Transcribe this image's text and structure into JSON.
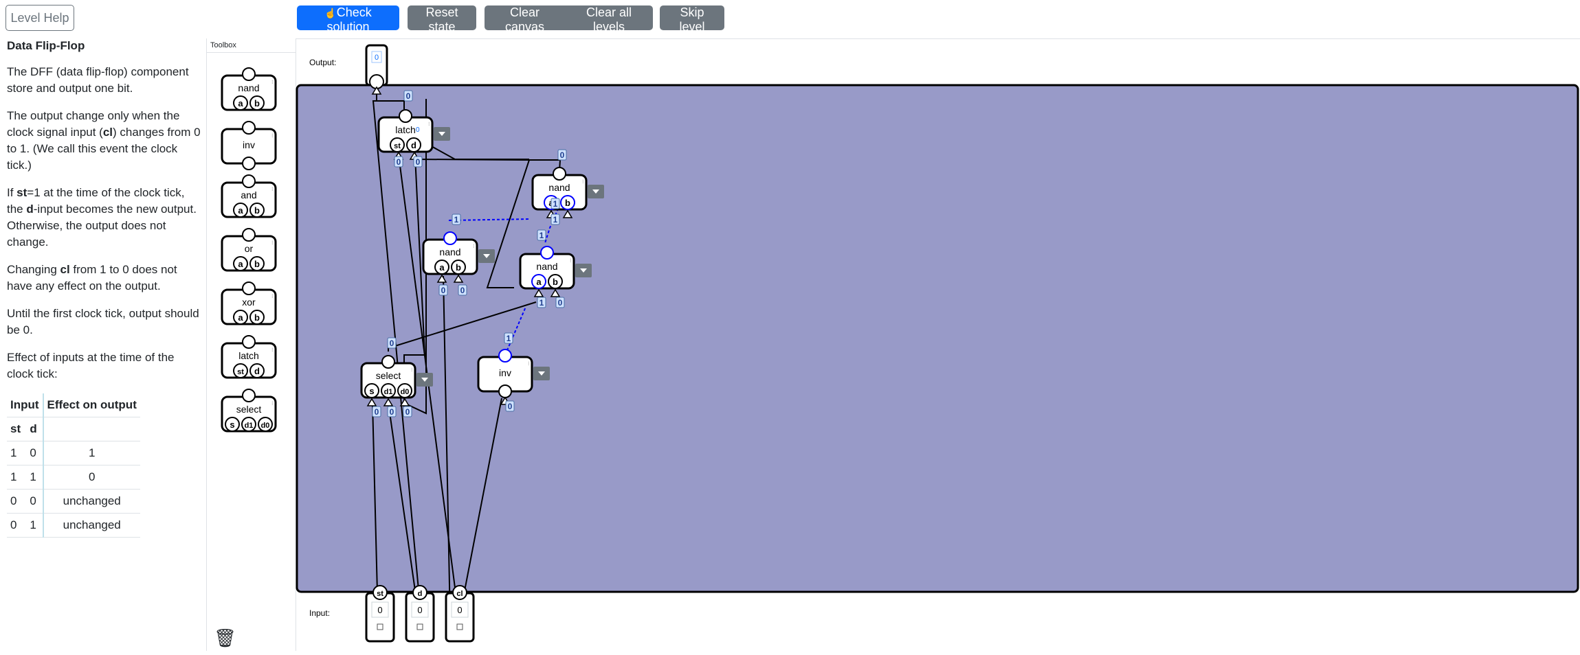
{
  "toolbar": {
    "level_help": "Level Help",
    "check": "Check solution",
    "reset": "Reset state",
    "clear_canvas": "Clear canvas",
    "clear_levels": "Clear all levels",
    "skip": "Skip level"
  },
  "help": {
    "title": "Data Flip-Flop",
    "p1": "The DFF (data flip-flop) component store and output one bit.",
    "p2a": "The output change only when the clock signal input (",
    "p2b": "cl",
    "p2c": ") changes from 0 to 1. (We call this event the clock tick.)",
    "p3a": "If ",
    "p3b": "st",
    "p3c": "=1 at the time of the clock tick, the ",
    "p3d": "d",
    "p3e": "-input becomes the new output. Otherwise, the output does not change.",
    "p4a": "Changing ",
    "p4b": "cl",
    "p4c": " from 1 to 0 does not have any effect on the output.",
    "p5": "Until the first clock tick, output should be 0.",
    "p6": "Effect of inputs at the time of the clock tick:",
    "table": {
      "h_input": "Input",
      "h_effect": "Effect on output",
      "h_st": "st",
      "h_d": "d",
      "rows": [
        {
          "st": "1",
          "d": "0",
          "effect": "1"
        },
        {
          "st": "1",
          "d": "1",
          "effect": "0"
        },
        {
          "st": "0",
          "d": "0",
          "effect": "unchanged"
        },
        {
          "st": "0",
          "d": "1",
          "effect": "unchanged"
        }
      ]
    }
  },
  "toolbox": {
    "title": "Toolbox",
    "items": [
      {
        "label": "nand",
        "pins": [
          "a",
          "b"
        ]
      },
      {
        "label": "inv",
        "pins": []
      },
      {
        "label": "and",
        "pins": [
          "a",
          "b"
        ]
      },
      {
        "label": "or",
        "pins": [
          "a",
          "b"
        ]
      },
      {
        "label": "xor",
        "pins": [
          "a",
          "b"
        ]
      },
      {
        "label": "latch",
        "pins": [
          "st",
          "d"
        ]
      },
      {
        "label": "select",
        "pins": [
          "s",
          "d1",
          "d0"
        ]
      }
    ]
  },
  "canvas": {
    "output_label": "Output:",
    "input_label": "Input:",
    "output_value": "0",
    "inputs": [
      {
        "name": "st",
        "value": "0"
      },
      {
        "name": "d",
        "value": "0"
      },
      {
        "name": "cl",
        "value": "0"
      }
    ],
    "components": {
      "latch": {
        "label": "latch",
        "pins": [
          "st",
          "d"
        ],
        "state": "0"
      },
      "nand_top": {
        "label": "nand",
        "pins": [
          "a",
          "b"
        ]
      },
      "nand_left": {
        "label": "nand",
        "pins": [
          "a",
          "b"
        ]
      },
      "nand_mid": {
        "label": "nand",
        "pins": [
          "a",
          "b"
        ]
      },
      "select": {
        "label": "select",
        "pins": [
          "s",
          "d1",
          "d0"
        ]
      },
      "inv": {
        "label": "inv"
      }
    },
    "wire_values": {
      "latch_out": "0",
      "latch_st": "0",
      "latch_d": "0",
      "nand_top_out": "0",
      "nand_top_a": "1",
      "nand_top_b": "1",
      "nand_left_out": "1",
      "nand_left_a": "0",
      "nand_left_b": "0",
      "nand_mid_out": "1",
      "nand_mid_a": "1",
      "nand_mid_b": "0",
      "select_out": "0",
      "select_s": "0",
      "select_d1": "0",
      "select_d0": "0",
      "inv_out": "1",
      "inv_in": "0"
    },
    "colors": {
      "canvas_bg": "#989ac8",
      "active_wire": "#0000ff",
      "value_badge": "#cfe2ff"
    }
  }
}
